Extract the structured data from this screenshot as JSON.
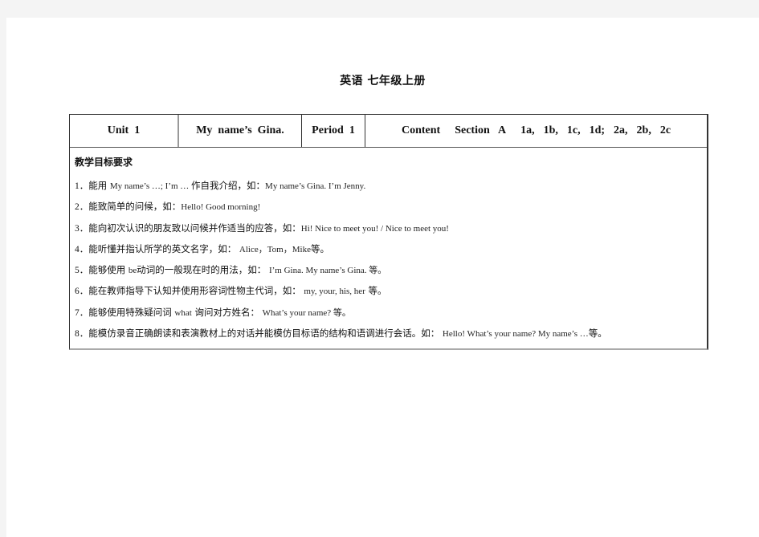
{
  "document": {
    "title": "英语  七年级上册"
  },
  "header_row": {
    "unit": "Unit  1",
    "lesson_title": "My  name’s  Gina.",
    "period": "Period  1",
    "content_label": "Content",
    "section": "Section  A",
    "parts": "1a,  1b,  1c,  1d;  2a,  2b,  2c"
  },
  "objectives": {
    "heading": "教学目标要求",
    "items": [
      {
        "num": "1．",
        "text": "能用 ",
        "en": "My name’s …; I’m … ",
        "text2": "作自我介绍，如：",
        "en2": "My name’s Gina. I’m Jenny."
      },
      {
        "num": "2．",
        "text": "能致简单的问候，如：",
        "en": "Hello!  Good  morning!",
        "text2": "",
        "en2": ""
      },
      {
        "num": "3．",
        "text": "能向初次认识的朋友致以问候并作适当的应答，如：",
        "en": "Hi!  Nice  to  meet  you!  /  Nice  to  meet  you!",
        "text2": "",
        "en2": ""
      },
      {
        "num": "4．",
        "text": "能听懂并指认所学的英文名字，如： ",
        "en": "Alice，Tom，Mike",
        "text2": "等。",
        "en2": ""
      },
      {
        "num": "5．",
        "text": "能够使用 ",
        "en": "be",
        "text2": "动词的一般现在时的用法，如： ",
        "en2": "I’m Gina.  My name’s Gina.  等。"
      },
      {
        "num": "6．",
        "text": "能在教师指导下认知并使用形容词性物主代词，如： ",
        "en": "my,  your,  his,  her",
        "text2": " 等。",
        "en2": ""
      },
      {
        "num": "7．",
        "text": "能够使用特殊疑问词 ",
        "en": "what",
        "text2": " 询问对方姓名： ",
        "en2": "What’s  your  name?  等。"
      },
      {
        "num": "8．",
        "text": "能模仿录音正确朗读和表演教材上的对话并能模仿目标语的结构和语调进行会话。如： ",
        "en": "Hello!  What’s  your  name?  My  name’s  …",
        "text2": "等。",
        "en2": ""
      }
    ]
  }
}
